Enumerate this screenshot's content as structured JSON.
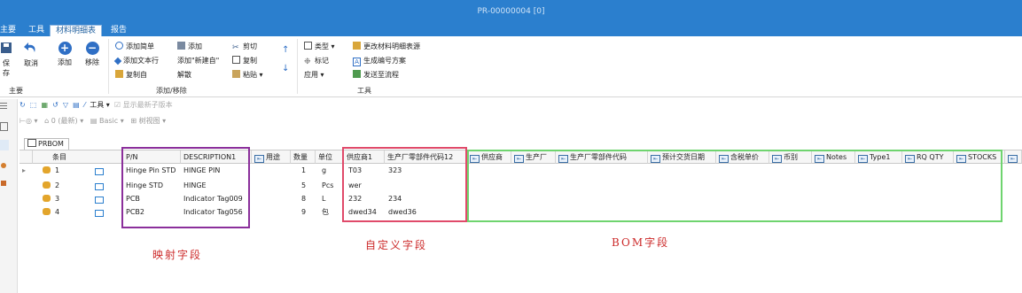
{
  "window": {
    "title": "PR-00000004 [0]"
  },
  "tabs": [
    {
      "label": "主要"
    },
    {
      "label": "工具"
    },
    {
      "label": "材料明细表"
    },
    {
      "label": "报告"
    }
  ],
  "ribbon": {
    "save": "保存",
    "cancel": "取消",
    "add": "添加",
    "remove": "移除",
    "add_simple": "添加简单",
    "add_text_row": "添加文本行",
    "copy_from": "复制自",
    "add2": "添加",
    "add_new_from": "添加\"新建自\"",
    "unbind": "解散",
    "cut": "剪切",
    "copy": "复制",
    "paste": "粘贴",
    "type": "类型",
    "mark": "标记",
    "apply": "应用",
    "change_bom_source": "更改材料明细表源",
    "gen_number_scheme": "生成编号方案",
    "send_to_workflow": "发送至流程",
    "group_main": "主要",
    "group_addremove": "添加/移除",
    "group_tools": "工具"
  },
  "toolbar2": {
    "tools": "工具",
    "show_latest": "显示最新子版本",
    "version": "0 (最新)",
    "basic": "Basic",
    "tree_view": "树视图"
  },
  "grid": {
    "tab_label": "PRBOM",
    "headers": [
      "条目",
      "P/N",
      "DESCRIPTION1",
      "用途",
      "数量",
      "单位",
      "供应商1",
      "生产厂零部件代码12",
      "供应商",
      "生产厂",
      "生产厂零部件代码",
      "预计交货日期",
      "含税单价",
      "币别",
      "Notes",
      "Type1",
      "RQ QTY",
      "STOCKS"
    ],
    "rows": [
      {
        "item": "1",
        "pn": "Hinge Pin STD",
        "desc": "HINGE PIN",
        "qty": "1",
        "unit": "g",
        "sup1": "T03",
        "code12": "323"
      },
      {
        "item": "2",
        "pn": "Hinge STD",
        "desc": "HINGE",
        "qty": "5",
        "unit": "Pcs",
        "sup1": "wer",
        "code12": ""
      },
      {
        "item": "3",
        "pn": "PCB",
        "desc": "Indicator Tag009",
        "qty": "8",
        "unit": "L",
        "sup1": "232",
        "code12": "234"
      },
      {
        "item": "4",
        "pn": "PCB2",
        "desc": "Indicator Tag056",
        "qty": "9",
        "unit": "包",
        "sup1": "dwed34",
        "code12": "dwed36"
      }
    ]
  },
  "annotations": {
    "mapped": "映射字段",
    "custom": "自定义字段",
    "bom": "BOM字段"
  },
  "colors": {
    "accent": "#2b7fce",
    "purple": "#8b2f9b",
    "red": "#e04a6a",
    "green": "#6fd46f",
    "annot": "#cc2a2a"
  }
}
